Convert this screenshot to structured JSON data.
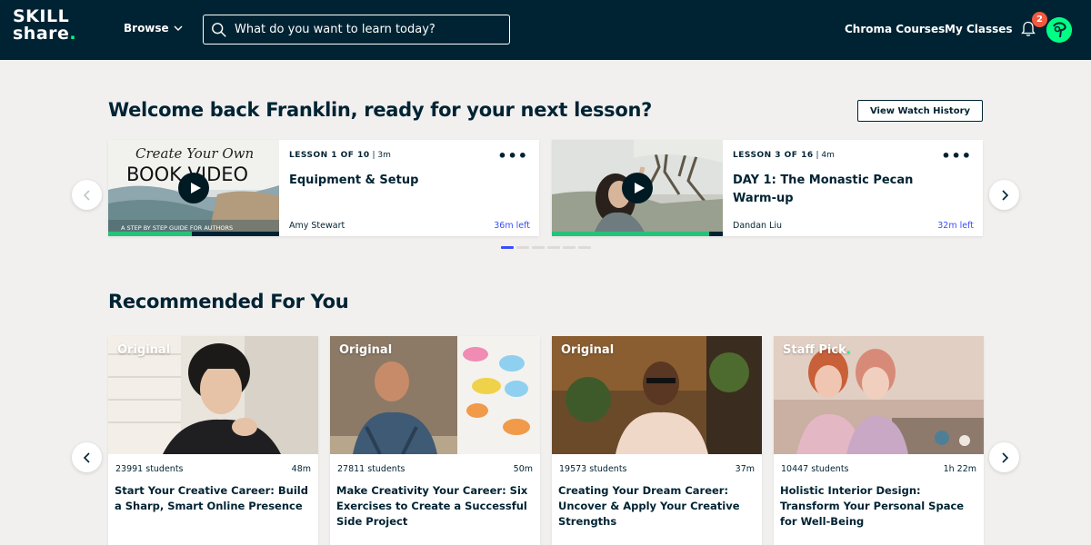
{
  "header": {
    "logo_line1": "SKILL",
    "logo_line2": "share",
    "browse_label": "Browse",
    "search_placeholder": "What do you want to learn today?",
    "nav_chroma": "Chroma Courses",
    "nav_my_classes": "My Classes",
    "notification_count": "2",
    "bell_icon": "bell-icon",
    "avatar_color": "#00ff84"
  },
  "welcome": {
    "title": "Welcome back Franklin, ready for your next lesson?",
    "history_button": "View Watch History",
    "lessons": [
      {
        "lesson_label": "LESSON 1 OF 10",
        "duration": "3m",
        "title": "Equipment & Setup",
        "author": "Amy Stewart",
        "time_left": "36m left",
        "progress": 0.49,
        "thumb_text_1": "Create Your Own",
        "thumb_text_2": "BOOK VIDEO",
        "thumb_text_3": "A STEP BY STEP GUIDE FOR AUTHORS"
      },
      {
        "lesson_label": "LESSON 3 OF 16",
        "duration": "4m",
        "title": "DAY 1: The Monastic Pecan Warm-up",
        "author": "Dandan Liu",
        "time_left": "32m left",
        "progress": 0.92
      }
    ]
  },
  "recommended": {
    "title": "Recommended For You",
    "courses": [
      {
        "tag": "Original",
        "students": "23991 students",
        "duration": "48m",
        "title": "Start Your Creative Career: Build a Sharp, Smart Online Presence"
      },
      {
        "tag": "Original",
        "students": "27811 students",
        "duration": "50m",
        "title": "Make Creativity Your Career: Six Exercises to Create a Successful Side Project"
      },
      {
        "tag": "Original",
        "students": "19573 students",
        "duration": "37m",
        "title": "Creating Your Dream Career: Uncover & Apply Your Creative Strengths"
      },
      {
        "tag": "Staff Pick",
        "students": "10447 students",
        "duration": "1h 22m",
        "title": "Holistic Interior Design: Transform Your Personal Space for Well-Being"
      }
    ]
  },
  "colors": {
    "header_bg": "#002333",
    "brand_green": "#00ff84",
    "accent_blue": "#394dff",
    "progress_green": "#25c27a",
    "badge_red": "#f25a3f"
  }
}
